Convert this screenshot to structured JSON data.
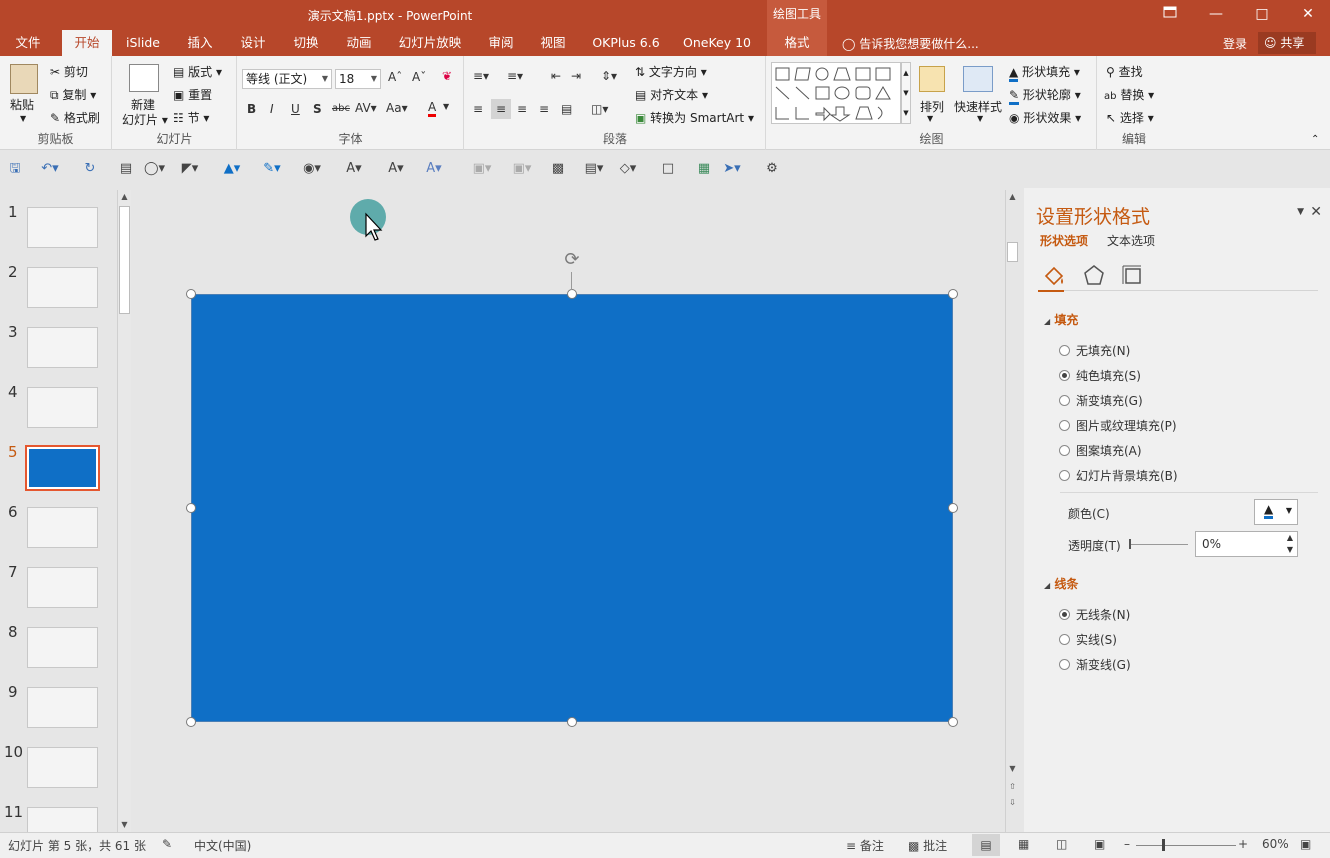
{
  "title_bar": {
    "document_title": "演示文稿1.pptx - PowerPoint",
    "context_tool": "绘图工具",
    "buttons": [
      "ribbon-display-icon",
      "minimize-icon",
      "maximize-icon",
      "close-icon"
    ]
  },
  "ribbon_tabs": {
    "items": [
      {
        "label": "文件",
        "active": false
      },
      {
        "label": "开始",
        "active": true
      },
      {
        "label": "iSlide",
        "active": false
      },
      {
        "label": "插入",
        "active": false
      },
      {
        "label": "设计",
        "active": false
      },
      {
        "label": "切换",
        "active": false
      },
      {
        "label": "动画",
        "active": false
      },
      {
        "label": "幻灯片放映",
        "active": false
      },
      {
        "label": "审阅",
        "active": false
      },
      {
        "label": "视图",
        "active": false
      },
      {
        "label": "OKPlus 6.6",
        "active": false
      },
      {
        "label": "OneKey 10",
        "active": false
      },
      {
        "label": "格式",
        "active": false,
        "contextual": true
      }
    ],
    "tell_me": "告诉我您想要做什么...",
    "sign_in": "登录",
    "share": "共享"
  },
  "ribbon": {
    "clipboard": {
      "paste": "粘贴",
      "cut": "剪切",
      "copy": "复制",
      "format_painter": "格式刷",
      "label": "剪贴板"
    },
    "slides": {
      "new_slide_line1": "新建",
      "new_slide_line2": "幻灯片",
      "layout": "版式",
      "reset": "重置",
      "section": "节",
      "label": "幻灯片"
    },
    "font": {
      "font_name": "等线 (正文)",
      "font_size": "18",
      "label": "字体"
    },
    "paragraph": {
      "text_direction": "文字方向",
      "align_text": "对齐文本",
      "smartart": "转换为 SmartArt",
      "label": "段落"
    },
    "drawing": {
      "arrange": "排列",
      "quick_styles": "快速样式",
      "shape_fill": "形状填充",
      "shape_outline": "形状轮廓",
      "shape_effects": "形状效果",
      "label": "绘图"
    },
    "editing": {
      "find": "查找",
      "replace": "替换",
      "select": "选择",
      "label": "编辑"
    }
  },
  "thumbnails": {
    "numbers": [
      "1",
      "2",
      "3",
      "4",
      "5",
      "6",
      "7",
      "8",
      "9",
      "10",
      "11"
    ],
    "active_index": 5
  },
  "format_pane": {
    "title": "设置形状格式",
    "tabs": [
      "形状选项",
      "文本选项"
    ],
    "fill_section": "填充",
    "fill_options": [
      {
        "label": "无填充(N)",
        "checked": false
      },
      {
        "label": "纯色填充(S)",
        "checked": true
      },
      {
        "label": "渐变填充(G)",
        "checked": false
      },
      {
        "label": "图片或纹理填充(P)",
        "checked": false
      },
      {
        "label": "图案填充(A)",
        "checked": false
      },
      {
        "label": "幻灯片背景填充(B)",
        "checked": false
      }
    ],
    "color_label": "颜色(C)",
    "transparency_label": "透明度(T)",
    "transparency_value": "0%",
    "line_section": "线条",
    "line_options": [
      {
        "label": "无线条(N)",
        "checked": true
      },
      {
        "label": "实线(S)",
        "checked": false
      },
      {
        "label": "渐变线(G)",
        "checked": false
      }
    ]
  },
  "status_bar": {
    "slide_info": "幻灯片 第 5 张，共 61 张",
    "language": "中文(中国)",
    "notes": "备注",
    "comments": "批注",
    "zoom": "60%"
  },
  "colors": {
    "accent": "#b7472a",
    "shape_fill": "#0f6fc6",
    "pane_title": "#c55a11"
  }
}
